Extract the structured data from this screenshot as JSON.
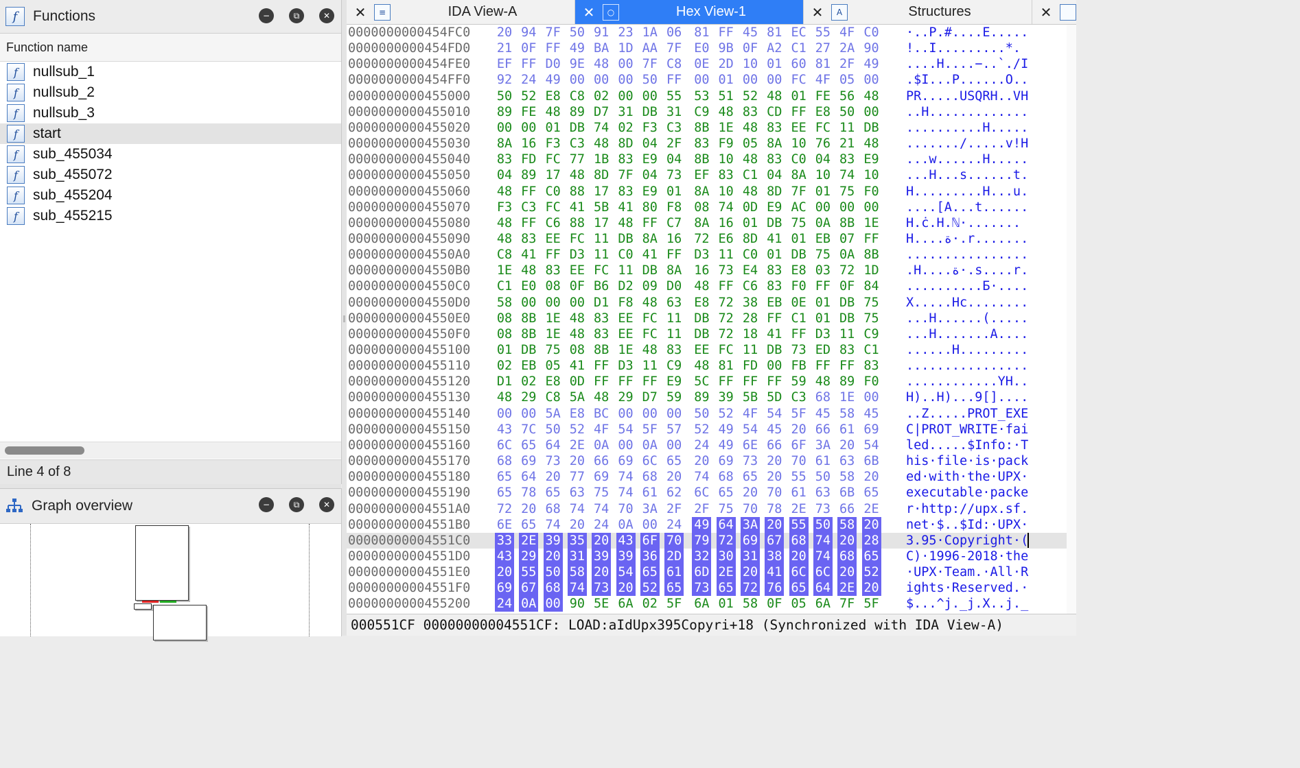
{
  "functions_panel": {
    "title": "Functions",
    "icon": "function-icon",
    "column_header": "Function name",
    "items": [
      "nullsub_1",
      "nullsub_2",
      "nullsub_3",
      "start",
      "sub_455034",
      "sub_455072",
      "sub_455204",
      "sub_455215"
    ],
    "selected_index": 3,
    "status": "Line 4 of 8"
  },
  "graph_overview": {
    "title": "Graph overview",
    "icon": "graph-overview-icon"
  },
  "panel_buttons": {
    "minimize_glyph": "−",
    "float_glyph": "⧉",
    "close_glyph": "✕"
  },
  "tabs": [
    {
      "label": "IDA View-A",
      "icon": "disassembly-view-icon",
      "icon_glyph": "≡",
      "close_glyph": "✕",
      "active": false
    },
    {
      "label": "Hex View-1",
      "icon": "hex-view-icon",
      "icon_glyph": "○",
      "close_glyph": "✕",
      "active": true
    },
    {
      "label": "Structures",
      "icon": "structures-icon",
      "icon_glyph": "A",
      "close_glyph": "✕",
      "active": false
    }
  ],
  "hex_view": {
    "colors": {
      "code": "#1a8a1a",
      "data": "#6f74e6",
      "ascii": "#1a1ae6",
      "selection": "#6a64f2",
      "address": "#6c6c6c"
    },
    "current_row_index": 32,
    "rows": [
      {
        "addr": "0000000000454FC0",
        "bytes": "20 94 7F 50 91 23 1A 06 81 FF 45 81 EC 55 4F C0",
        "ascii": "·..P.#....E.....",
        "color": "data"
      },
      {
        "addr": "0000000000454FD0",
        "bytes": "21 0F FF 49 BA 1D AA 7F E0 9B 0F A2 C1 27 2A 90",
        "ascii": "!..I.........*.",
        "color": "data"
      },
      {
        "addr": "0000000000454FE0",
        "bytes": "EF FF D0 9E 48 00 7F C8 0E 2D 10 01 60 81 2F 49",
        "ascii": "....H....−..`./I",
        "color": "data"
      },
      {
        "addr": "0000000000454FF0",
        "bytes": "92 24 49 00 00 00 50 FF 00 01 00 00 FC 4F 05 00",
        "ascii": ".$I...P......O..",
        "color": "data"
      },
      {
        "addr": "0000000000455000",
        "bytes": "50 52 E8 C8 02 00 00 55 53 51 52 48 01 FE 56 48",
        "ascii": "PR.....USQRH..VH",
        "color": "code"
      },
      {
        "addr": "0000000000455010",
        "bytes": "89 FE 48 89 D7 31 DB 31 C9 48 83 CD FF E8 50 00",
        "ascii": "..H.............",
        "color": "code"
      },
      {
        "addr": "0000000000455020",
        "bytes": "00 00 01 DB 74 02 F3 C3 8B 1E 48 83 EE FC 11 DB",
        "ascii": "..........H.....",
        "color": "code"
      },
      {
        "addr": "0000000000455030",
        "bytes": "8A 16 F3 C3 48 8D 04 2F 83 F9 05 8A 10 76 21 48",
        "ascii": "......./.....v!H",
        "color": "code"
      },
      {
        "addr": "0000000000455040",
        "bytes": "83 FD FC 77 1B 83 E9 04 8B 10 48 83 C0 04 83 E9",
        "ascii": "...w......H.....",
        "color": "code"
      },
      {
        "addr": "0000000000455050",
        "bytes": "04 89 17 48 8D 7F 04 73 EF 83 C1 04 8A 10 74 10",
        "ascii": "...H...s......t.",
        "color": "code"
      },
      {
        "addr": "0000000000455060",
        "bytes": "48 FF C0 88 17 83 E9 01 8A 10 48 8D 7F 01 75 F0",
        "ascii": "H.........H...u.",
        "color": "code"
      },
      {
        "addr": "0000000000455070",
        "bytes": "F3 C3 FC 41 5B 41 80 F8 08 74 0D E9 AC 00 00 00",
        "ascii": "....[A...t......",
        "color": "code"
      },
      {
        "addr": "0000000000455080",
        "bytes": "48 FF C6 88 17 48 FF C7 8A 16 01 DB 75 0A 8B 1E",
        "ascii": "H.ċ.H.ℕ·.......",
        "color": "code"
      },
      {
        "addr": "0000000000455090",
        "bytes": "48 83 EE FC 11 DB 8A 16 72 E6 8D 41 01 EB 07 FF",
        "ascii": "H....ة·.r.......",
        "color": "code"
      },
      {
        "addr": "00000000004550A0",
        "bytes": "C8 41 FF D3 11 C0 41 FF D3 11 C0 01 DB 75 0A 8B",
        "ascii": "................",
        "color": "code"
      },
      {
        "addr": "00000000004550B0",
        "bytes": "1E 48 83 EE FC 11 DB 8A 16 73 E4 83 E8 03 72 1D",
        "ascii": ".H....ة·.s....r.",
        "color": "code"
      },
      {
        "addr": "00000000004550C0",
        "bytes": "C1 E0 08 0F B6 D2 09 D0 48 FF C6 83 F0 FF 0F 84",
        "ascii": "..........Б·....",
        "color": "code"
      },
      {
        "addr": "00000000004550D0",
        "bytes": "58 00 00 00 D1 F8 48 63 E8 72 38 EB 0E 01 DB 75",
        "ascii": "X.....Hc........",
        "color": "code"
      },
      {
        "addr": "00000000004550E0",
        "bytes": "08 8B 1E 48 83 EE FC 11 DB 72 28 FF C1 01 DB 75",
        "ascii": "...H......(.....",
        "color": "code"
      },
      {
        "addr": "00000000004550F0",
        "bytes": "08 8B 1E 48 83 EE FC 11 DB 72 18 41 FF D3 11 C9",
        "ascii": "...H.......A....",
        "color": "code"
      },
      {
        "addr": "0000000000455100",
        "bytes": "01 DB 75 08 8B 1E 48 83 EE FC 11 DB 73 ED 83 C1",
        "ascii": "......H.........",
        "color": "code"
      },
      {
        "addr": "0000000000455110",
        "bytes": "02 EB 05 41 FF D3 11 C9 48 81 FD 00 FB FF FF 83",
        "ascii": "................",
        "color": "code"
      },
      {
        "addr": "0000000000455120",
        "bytes": "D1 02 E8 0D FF FF FF E9 5C FF FF FF 59 48 89 F0",
        "ascii": "............YH..",
        "color": "code"
      },
      {
        "addr": "0000000000455130",
        "bytes": "48 29 C8 5A 48 29 D7 59 89 39 5B 5D C3 68 1E 00",
        "ascii": "H)..H)...9[]....",
        "color": "code",
        "data_from": 13
      },
      {
        "addr": "0000000000455140",
        "bytes": "00 00 5A E8 BC 00 00 00 50 52 4F 54 5F 45 58 45",
        "ascii": "..Z.....PROT_EXE",
        "color": "data"
      },
      {
        "addr": "0000000000455150",
        "bytes": "43 7C 50 52 4F 54 5F 57 52 49 54 45 20 66 61 69",
        "ascii": "C|PROT_WRITE·fai",
        "color": "data"
      },
      {
        "addr": "0000000000455160",
        "bytes": "6C 65 64 2E 0A 00 0A 00 24 49 6E 66 6F 3A 20 54",
        "ascii": "led.....$Info:·T",
        "color": "data"
      },
      {
        "addr": "0000000000455170",
        "bytes": "68 69 73 20 66 69 6C 65 20 69 73 20 70 61 63 6B",
        "ascii": "his·file·is·pack",
        "color": "data"
      },
      {
        "addr": "0000000000455180",
        "bytes": "65 64 20 77 69 74 68 20 74 68 65 20 55 50 58 20",
        "ascii": "ed·with·the·UPX·",
        "color": "data"
      },
      {
        "addr": "0000000000455190",
        "bytes": "65 78 65 63 75 74 61 62 6C 65 20 70 61 63 6B 65",
        "ascii": "executable·packe",
        "color": "data"
      },
      {
        "addr": "00000000004551A0",
        "bytes": "72 20 68 74 74 70 3A 2F 2F 75 70 78 2E 73 66 2E",
        "ascii": "r·http://upx.sf.",
        "color": "data"
      },
      {
        "addr": "00000000004551B0",
        "bytes": "6E 65 74 20 24 0A 00 24 49 64 3A 20 55 50 58 20",
        "ascii": "net·$..$Id:·UPX·",
        "color": "data",
        "sel_from": 8,
        "sel_to": 16
      },
      {
        "addr": "00000000004551C0",
        "bytes": "33 2E 39 35 20 43 6F 70 79 72 69 67 68 74 20 28",
        "ascii": "3.95·Copyright·(",
        "color": "data",
        "sel_from": 0,
        "sel_to": 16
      },
      {
        "addr": "00000000004551D0",
        "bytes": "43 29 20 31 39 39 36 2D 32 30 31 38 20 74 68 65",
        "ascii": "C)·1996-2018·the",
        "color": "data",
        "sel_from": 0,
        "sel_to": 16
      },
      {
        "addr": "00000000004551E0",
        "bytes": "20 55 50 58 20 54 65 61 6D 2E 20 41 6C 6C 20 52",
        "ascii": "·UPX·Team.·All·R",
        "color": "data",
        "sel_from": 0,
        "sel_to": 16
      },
      {
        "addr": "00000000004551F0",
        "bytes": "69 67 68 74 73 20 52 65 73 65 72 76 65 64 2E 20",
        "ascii": "ights·Reserved.·",
        "color": "data",
        "sel_from": 0,
        "sel_to": 16
      },
      {
        "addr": "0000000000455200",
        "bytes": "24 0A 00 90 5E 6A 02 5F 6A 01 58 0F 05 6A 7F 5F",
        "ascii": "$...^j._j.X..j._",
        "color": "code",
        "sel_from": 0,
        "sel_to": 3
      }
    ]
  },
  "status_bar": {
    "text": "000551CF 00000000004551CF: LOAD:aIdUpx395Copyri+18 (Synchronized with IDA View-A)"
  }
}
